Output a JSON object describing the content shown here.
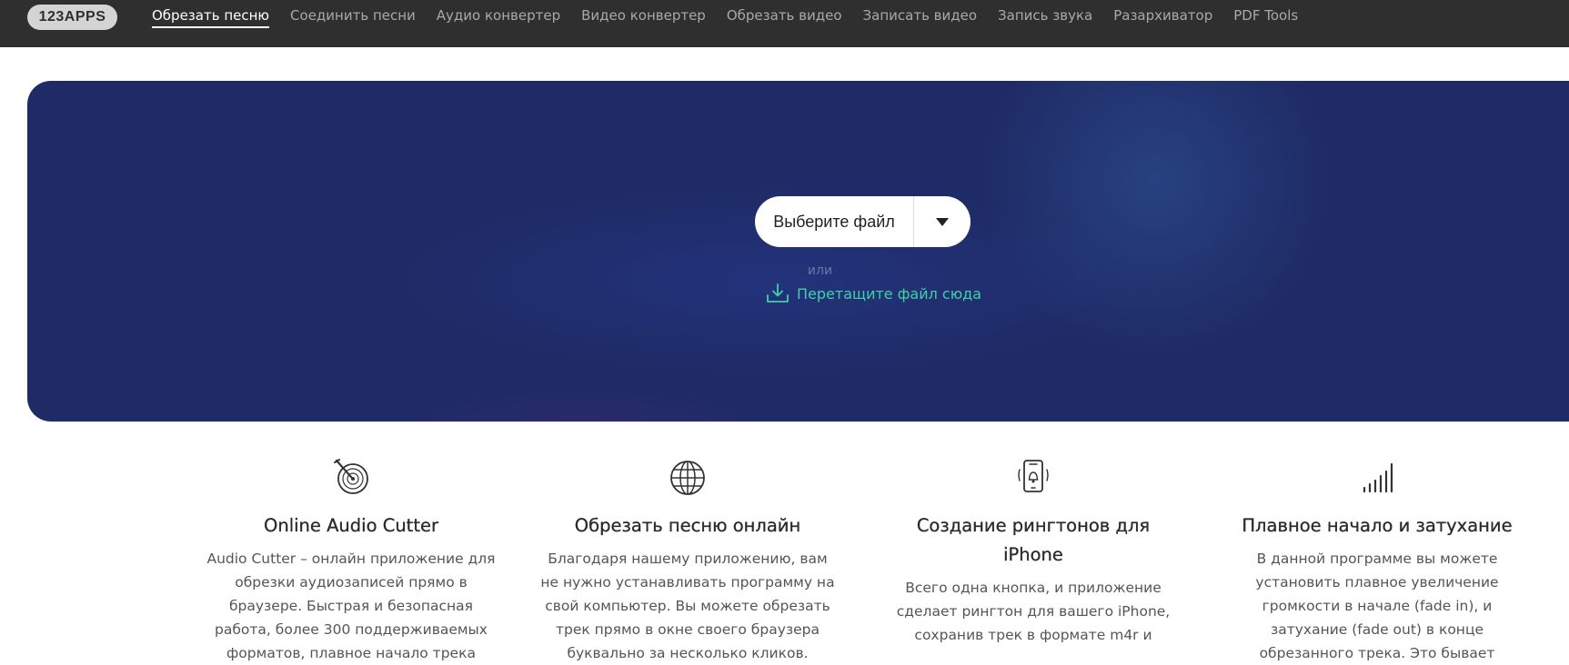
{
  "header": {
    "logo": "123APPS",
    "nav": [
      {
        "label": "Обрезать песню",
        "active": true
      },
      {
        "label": "Соединить песни"
      },
      {
        "label": "Аудио конвертер"
      },
      {
        "label": "Видео конвертер"
      },
      {
        "label": "Обрезать видео"
      },
      {
        "label": "Записать видео"
      },
      {
        "label": "Запись звука"
      },
      {
        "label": "Разархиватор"
      },
      {
        "label": "PDF Tools"
      }
    ]
  },
  "hero": {
    "choose_file_label": "Выберите файл",
    "dropdown_icon": "triangle-down-icon",
    "or_text": "или",
    "drop_label": "Перетащите файл сюда",
    "drop_icon": "download-tray-icon",
    "accent_color": "#3ed2a3",
    "background_color": "#1f2b66"
  },
  "features": [
    {
      "icon": "vinyl-cut-icon",
      "title": "Online Audio Cutter",
      "text": "Audio Cutter – онлайн приложение для\nобрезки аудиозаписей прямо в\nбраузере. Быстрая и безопасная\nработа, более 300 поддерживаемых\nформатов, плавное начало трека"
    },
    {
      "icon": "globe-icon",
      "title": "Обрезать песню онлайн",
      "text": "Благодаря нашему приложению, вам\nне нужно устанавливать программу на\nсвой компьютер. Вы можете обрезать\nтрек прямо в окне своего браузера\nбуквально за несколько кликов."
    },
    {
      "icon": "phone-bell-icon",
      "title": "Создание рингтонов для iPhone",
      "text": "Всего одна кнопка, и приложение\nсделает рингтон для вашего iPhone,\nсохранив трек в формате m4r и"
    },
    {
      "icon": "signal-bars-icon",
      "title": "Плавное начало и затухание",
      "text": "В данной программе вы можете\nустановить плавное увеличение\nгромкости в начале (fade in), и\nзатухание (fade out) в конце\nобрезанного трека. Это бывает"
    }
  ]
}
